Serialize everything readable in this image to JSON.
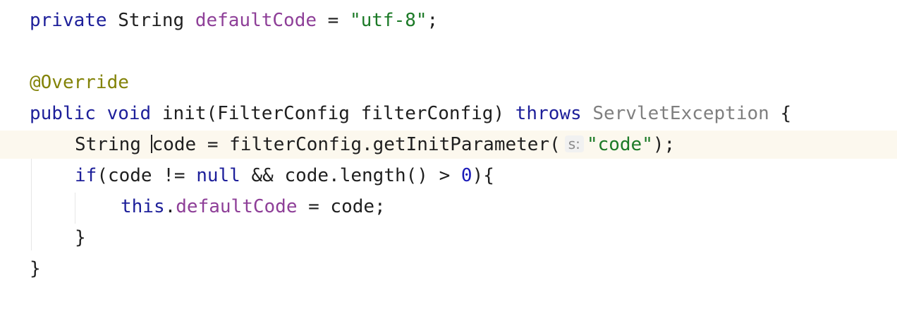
{
  "editor": {
    "lines": [
      {
        "tokens": [
          {
            "text": "private",
            "type": "keyword"
          },
          {
            "text": " String ",
            "type": "plain"
          },
          {
            "text": "defaultCode",
            "type": "field"
          },
          {
            "text": " = ",
            "type": "plain"
          },
          {
            "text": "\"utf-8\"",
            "type": "string"
          },
          {
            "text": ";",
            "type": "plain"
          }
        ]
      },
      {
        "tokens": [
          {
            "text": "@Override",
            "type": "annotation"
          }
        ]
      },
      {
        "tokens": [
          {
            "text": "public",
            "type": "keyword"
          },
          {
            "text": " ",
            "type": "plain"
          },
          {
            "text": "void",
            "type": "keyword"
          },
          {
            "text": " init(FilterConfig filterConfig) ",
            "type": "plain"
          },
          {
            "text": "throws",
            "type": "keyword"
          },
          {
            "text": " ",
            "type": "plain"
          },
          {
            "text": "ServletException",
            "type": "dim"
          },
          {
            "text": " {",
            "type": "plain"
          }
        ]
      },
      {
        "current": true,
        "tokens": [
          {
            "text": "String ",
            "type": "plain"
          },
          {
            "text": "",
            "type": "caret"
          },
          {
            "text": "code = filterConfig.getInitParameter(",
            "type": "plain"
          },
          {
            "text": "s:",
            "type": "hint"
          },
          {
            "text": "\"code\"",
            "type": "string"
          },
          {
            "text": ");",
            "type": "plain"
          }
        ]
      },
      {
        "tokens": [
          {
            "text": "if",
            "type": "keyword"
          },
          {
            "text": "(code != ",
            "type": "plain"
          },
          {
            "text": "null",
            "type": "keyword"
          },
          {
            "text": " && code.length() > ",
            "type": "plain"
          },
          {
            "text": "0",
            "type": "number"
          },
          {
            "text": "){",
            "type": "plain"
          }
        ]
      },
      {
        "tokens": [
          {
            "text": "this",
            "type": "keyword"
          },
          {
            "text": ".",
            "type": "plain"
          },
          {
            "text": "defaultCode",
            "type": "field"
          },
          {
            "text": " = code;",
            "type": "plain"
          }
        ]
      },
      {
        "tokens": [
          {
            "text": "}",
            "type": "plain"
          }
        ]
      },
      {
        "tokens": [
          {
            "text": "}",
            "type": "plain"
          }
        ]
      }
    ]
  }
}
